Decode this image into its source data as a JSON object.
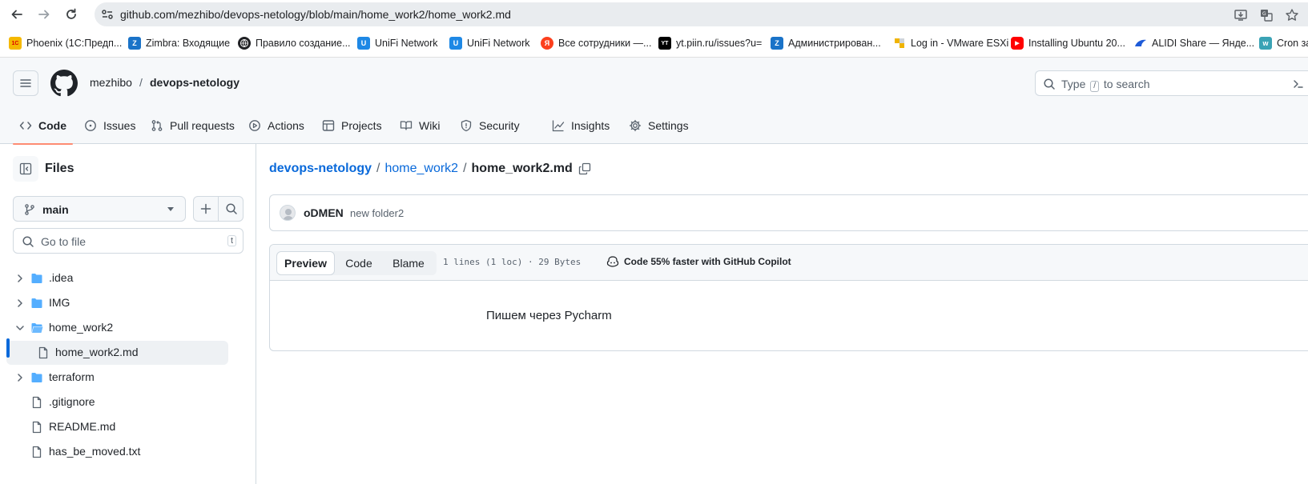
{
  "browser": {
    "url": "github.com/mezhibo/devops-netology/blob/main/home_work2/home_work2.md",
    "bookmarks": [
      {
        "label": "Phoenix (1С:Предп...",
        "badge": "1С",
        "color": "#f5b800",
        "icon": "1c-favicon"
      },
      {
        "label": "Zimbra: Входящие",
        "badge": "Z",
        "color": "#1a73c8",
        "icon": "zimbra-favicon"
      },
      {
        "label": "Правило создание...",
        "badge": "",
        "color": "#202124",
        "icon": "globe-favicon"
      },
      {
        "label": "UniFi Network",
        "badge": "U",
        "color": "#1e88e5",
        "icon": "unifi-favicon"
      },
      {
        "label": "UniFi Network",
        "badge": "U",
        "color": "#1e88e5",
        "icon": "unifi-favicon"
      },
      {
        "label": "Все сотрудники —...",
        "badge": "Я",
        "color": "#fc3f1d",
        "icon": "yandex-favicon"
      },
      {
        "label": "yt.piin.ru/issues?u=",
        "badge": "YT",
        "color": "#000000",
        "icon": "youtrack-favicon"
      },
      {
        "label": "Администрирован...",
        "badge": "Z",
        "color": "#1a73c8",
        "icon": "zimbra-favicon"
      },
      {
        "label": "Log in - VMware ESXi",
        "badge": "",
        "color": "#f0b400",
        "icon": "vmware-favicon"
      },
      {
        "label": "Installing Ubuntu 20...",
        "badge": "▶",
        "color": "#ff0000",
        "icon": "youtube-favicon"
      },
      {
        "label": "ALIDI Share — Янде...",
        "badge": "",
        "color": "#1e5bd8",
        "icon": "yandex-disk-favicon"
      },
      {
        "label": "Cron за",
        "badge": "w",
        "color": "#3aa3b5",
        "icon": "w-favicon"
      }
    ]
  },
  "repo": {
    "owner": "mezhibo",
    "separator": "/",
    "name": "devops-netology"
  },
  "search": {
    "prefix": "Type",
    "key": "/",
    "suffix": "to search"
  },
  "tabs": [
    {
      "label": "Code",
      "icon": "code-icon",
      "active": true
    },
    {
      "label": "Issues",
      "icon": "issue-icon"
    },
    {
      "label": "Pull requests",
      "icon": "pull-request-icon"
    },
    {
      "label": "Actions",
      "icon": "play-icon"
    },
    {
      "label": "Projects",
      "icon": "table-icon"
    },
    {
      "label": "Wiki",
      "icon": "book-icon"
    },
    {
      "label": "Security",
      "icon": "shield-icon"
    },
    {
      "label": "Insights",
      "icon": "graph-icon"
    },
    {
      "label": "Settings",
      "icon": "gear-icon"
    }
  ],
  "sidebar": {
    "title": "Files",
    "branch": "main",
    "goto_placeholder": "Go to file",
    "goto_key": "t",
    "tree": [
      {
        "label": ".idea",
        "type": "folder",
        "expanded": false
      },
      {
        "label": "IMG",
        "type": "folder",
        "expanded": false
      },
      {
        "label": "home_work2",
        "type": "folder",
        "expanded": true
      },
      {
        "label": "home_work2.md",
        "type": "file",
        "selected": true
      },
      {
        "label": "terraform",
        "type": "folder",
        "expanded": false
      },
      {
        "label": ".gitignore",
        "type": "file"
      },
      {
        "label": "README.md",
        "type": "file"
      },
      {
        "label": "has_be_moved.txt",
        "type": "file"
      }
    ]
  },
  "main": {
    "crumb_repo": "devops-netology",
    "crumb_sep": "/",
    "crumb_folder": "home_work2",
    "crumb_file": "home_work2.md",
    "commit_author": "oDMEN",
    "commit_message": "new folder2",
    "view_preview": "Preview",
    "view_code": "Code",
    "view_blame": "Blame",
    "file_meta": "1 lines (1 loc) · 29 Bytes",
    "copilot": "Code 55% faster with GitHub Copilot",
    "content": "Пишем через Pycharm"
  },
  "colors": {
    "link": "#0969da",
    "active_tab_underline": "#fd8c73",
    "header_bg": "#f6f8fa"
  }
}
